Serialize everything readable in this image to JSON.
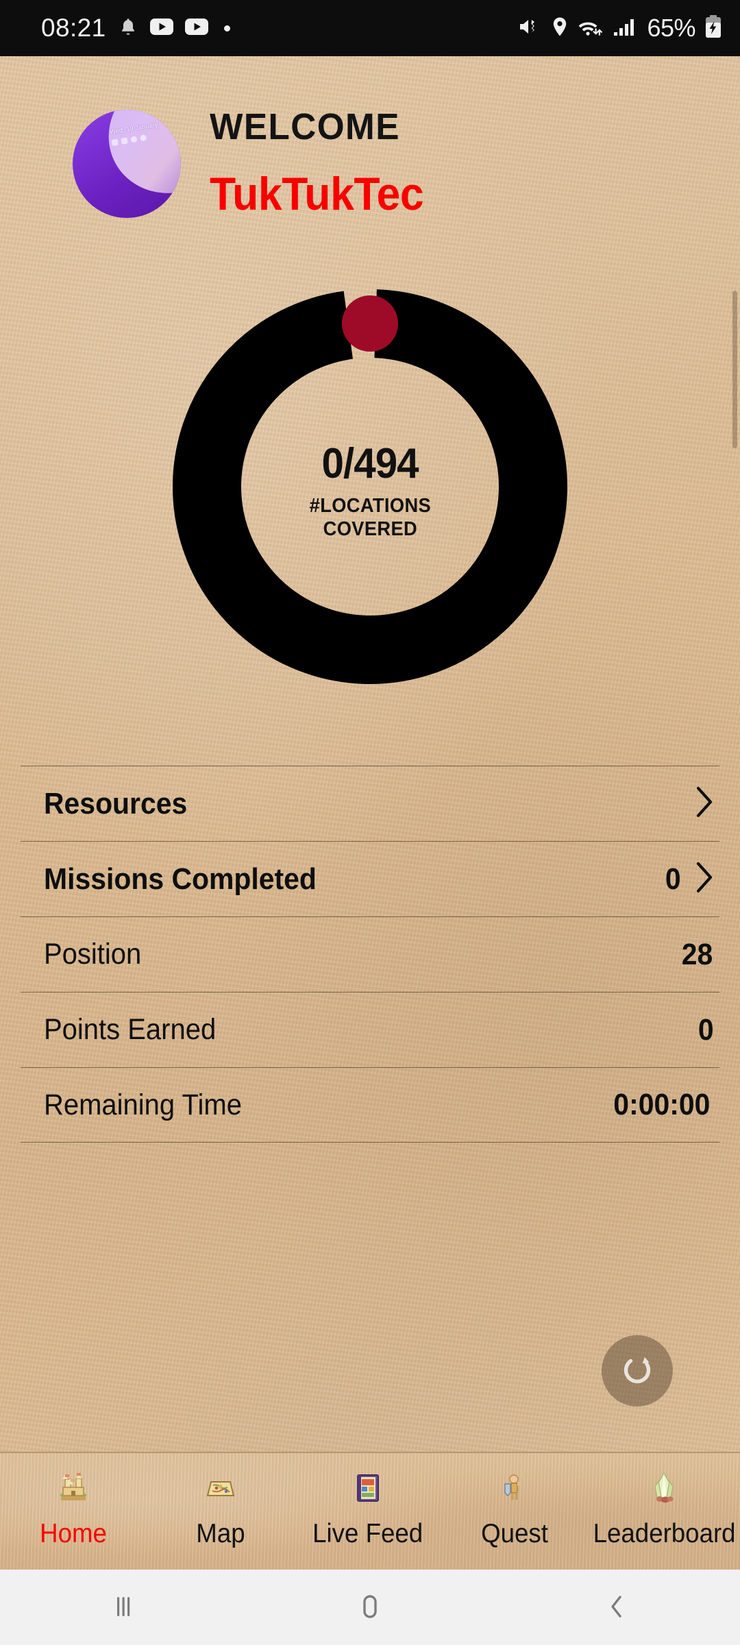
{
  "status_bar": {
    "time": "08:21",
    "battery_percent": "65%",
    "left_icons": [
      "bell-icon",
      "youtube-icon",
      "youtube-icon",
      "dot-indicator-icon"
    ],
    "right_icons": [
      "mute-vibrate-icon",
      "location-icon",
      "wifi-icon",
      "signal-icon",
      "battery-charging-icon"
    ]
  },
  "header": {
    "welcome_label": "WELCOME",
    "username": "TukTukTec",
    "avatar": {
      "name": "user-avatar",
      "date_text": "Wed, 19 January"
    }
  },
  "progress_ring": {
    "value_text": "0/494",
    "covered": 0,
    "total": 494,
    "percent": 0,
    "label_line1": "#LOCATIONS",
    "label_line2": "COVERED",
    "track_color": "#000000",
    "knob_color": "#9e0b28"
  },
  "stats": [
    {
      "label": "Resources",
      "value": "",
      "bold": true,
      "chevron": true
    },
    {
      "label": "Missions Completed",
      "value": "0",
      "bold": true,
      "chevron": true
    },
    {
      "label": "Position",
      "value": "28",
      "bold": false,
      "chevron": false
    },
    {
      "label": "Points Earned",
      "value": "0",
      "bold": false,
      "chevron": false
    },
    {
      "label": "Remaining Time",
      "value": "0:00:00",
      "bold": false,
      "chevron": false
    }
  ],
  "refresh_button": {
    "name": "refresh-button",
    "icon": "refresh-icon"
  },
  "tabs": [
    {
      "label": "Home",
      "icon": "castle-icon",
      "active": true
    },
    {
      "label": "Map",
      "icon": "map-icon",
      "active": false
    },
    {
      "label": "Live Feed",
      "icon": "book-icon",
      "active": false
    },
    {
      "label": "Quest",
      "icon": "knight-icon",
      "active": false
    },
    {
      "label": "Leaderboard",
      "icon": "crystal-icon",
      "active": false
    }
  ],
  "android_nav": {
    "recents_label": "recents-icon",
    "home_label": "home-icon",
    "back_label": "back-icon"
  },
  "colors": {
    "accent_red": "#f80000",
    "background_sand": "#dcbc94",
    "ring_black": "#000000",
    "ring_knob_crimson": "#9e0b28",
    "status_bar_black": "#0d0d0d"
  }
}
